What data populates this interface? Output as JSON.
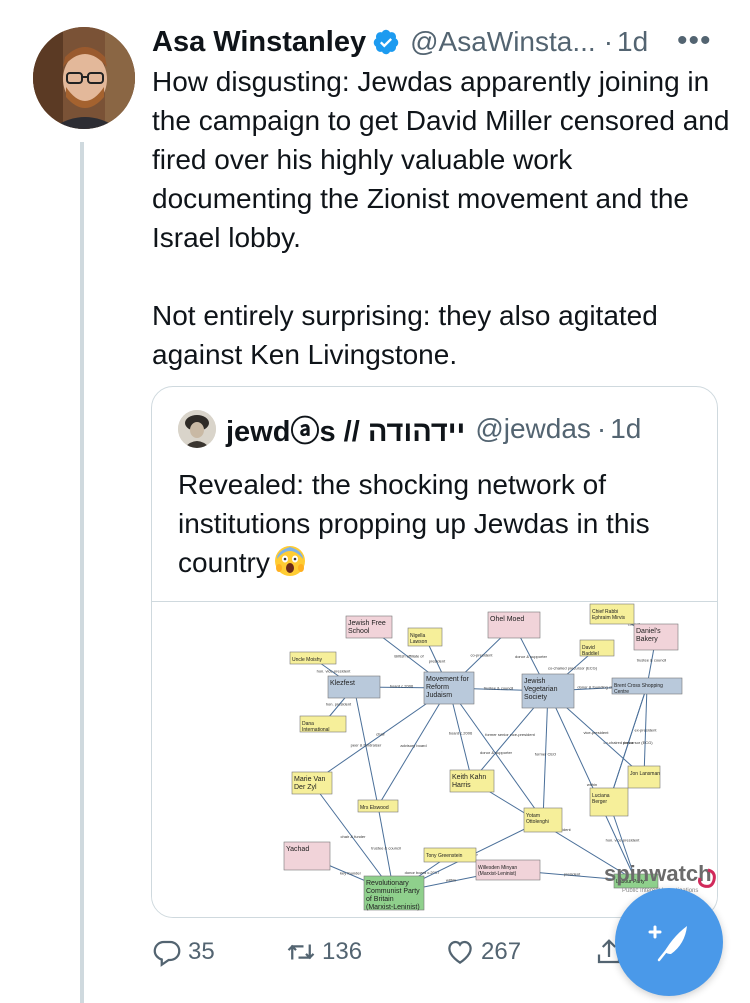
{
  "tweet": {
    "author_name": "Asa Winstanley",
    "author_handle": "@AsaWinsta...",
    "separator": "·",
    "time": "1d",
    "more": "•••",
    "paragraphs": [
      "How disgusting: Jewdas apparently joining in the campaign to get David Miller censored and fired over his highly valuable work documenting the Zionist movement and the Israel lobby.",
      "Not entirely surprising: they also agitated against Ken Livingstone."
    ]
  },
  "quoted_tweet": {
    "author_name": "jewdⓐs // יידהודה",
    "author_handle": "@jewdas",
    "separator": "·",
    "time": "1d",
    "text": "Revealed: the shocking network of institutions propping up Jewdas in this country",
    "image": {
      "brand": "spinwatch",
      "subtitle": "Public Interest Investigations",
      "nodes": [
        {
          "label": "Jewish Free School",
          "color": "#f1d3d9"
        },
        {
          "label": "Nigella Lawson",
          "color": "#f6ef9a"
        },
        {
          "label": "Ohel Moed",
          "color": "#f1d3d9"
        },
        {
          "label": "Chief Rabbi Ephraim Mirvis",
          "color": "#f6ef9a"
        },
        {
          "label": "Daniel's Bakery",
          "color": "#f1d3d9"
        },
        {
          "label": "David Baddiel",
          "color": "#f6ef9a"
        },
        {
          "label": "Uncle Moishy",
          "color": "#f6ef9a"
        },
        {
          "label": "Klezfest",
          "color": "#b9c9db"
        },
        {
          "label": "Movement for Reform Judaism",
          "color": "#b9c9db"
        },
        {
          "label": "Jewish Vegetarian Society",
          "color": "#b9c9db"
        },
        {
          "label": "Brent Cross Shopping Centre",
          "color": "#b9c9db"
        },
        {
          "label": "Dana International",
          "color": "#f6ef9a"
        },
        {
          "label": "Marie Van Der Zyl",
          "color": "#f6ef9a"
        },
        {
          "label": "Keith Kahn Harris",
          "color": "#f6ef9a"
        },
        {
          "label": "Jon Lansman",
          "color": "#f6ef9a"
        },
        {
          "label": "Luciana Berger",
          "color": "#f6ef9a"
        },
        {
          "label": "Mrs Elswood",
          "color": "#f6ef9a"
        },
        {
          "label": "Yotam Ottolenghi",
          "color": "#f6ef9a"
        },
        {
          "label": "Yachad",
          "color": "#f1d3d9"
        },
        {
          "label": "Tony Greenstein",
          "color": "#f6ef9a"
        },
        {
          "label": "Willesden Minyan (Marxist-Leninist)",
          "color": "#f1d3d9"
        },
        {
          "label": "Labour Party",
          "color": "#8fd08c"
        },
        {
          "label": "Revolutionary Communist Party of Britain (Marxist-Leninist)",
          "color": "#8fd08c"
        }
      ],
      "edge_labels": [
        "British affiliate of",
        "president",
        "co-president",
        "council",
        "co-chaired precursor (ECG)",
        "hon. vice-president",
        "board c.2006",
        "trustee & council",
        "donor & founding chair",
        "hon. president",
        "chair",
        "former senior vice-president",
        "ex-president",
        "co-chaired precursor (ECG)",
        "advisory board",
        "former CEO",
        "key founder",
        "donor board c.2007",
        "president",
        "chair & funder",
        "trustee & council",
        "honorary president",
        "hon. vice-president",
        "board c.2006",
        "vice-president",
        "donor",
        "donor & supporter",
        "trustee & council",
        "peer & fundraiser",
        "former MP",
        "within",
        "donor & supporter",
        "within"
      ]
    }
  },
  "actions": {
    "reply_count": "35",
    "retweet_count": "136",
    "like_count": "267"
  },
  "colors": {
    "accent": "#1d9bf0",
    "fab": "#4a99e9",
    "muted": "#536471",
    "border": "#cfd9de"
  }
}
